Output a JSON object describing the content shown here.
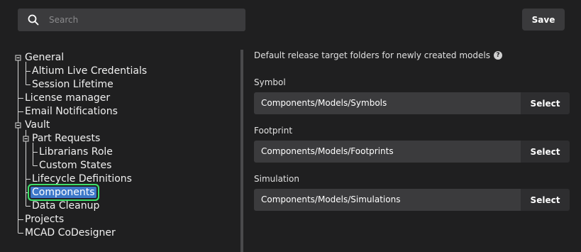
{
  "search": {
    "placeholder": "Search",
    "icon": "search-icon"
  },
  "toolbar": {
    "save_label": "Save"
  },
  "tree": {
    "items": [
      {
        "label": "General"
      },
      {
        "label": "Altium Live Credentials"
      },
      {
        "label": "Session Lifetime"
      },
      {
        "label": "License manager"
      },
      {
        "label": "Email Notifications"
      },
      {
        "label": "Vault"
      },
      {
        "label": "Part Requests"
      },
      {
        "label": "Librarians Role"
      },
      {
        "label": "Custom States"
      },
      {
        "label": "Lifecycle Definitions"
      },
      {
        "label": "Components",
        "selected": true
      },
      {
        "label": "Data Cleanup"
      },
      {
        "label": "Projects"
      },
      {
        "label": "MCAD CoDesigner"
      }
    ],
    "selected_color": "#3d78c9",
    "highlight_color": "#3ee06a"
  },
  "panel": {
    "description": "Default release target folders for newly created models",
    "help_icon": "?",
    "fields": [
      {
        "label": "Symbol",
        "value": "Components/Models/Symbols",
        "button": "Select"
      },
      {
        "label": "Footprint",
        "value": "Components/Models/Footprints",
        "button": "Select"
      },
      {
        "label": "Simulation",
        "value": "Components/Models/Simulations",
        "button": "Select"
      }
    ]
  }
}
